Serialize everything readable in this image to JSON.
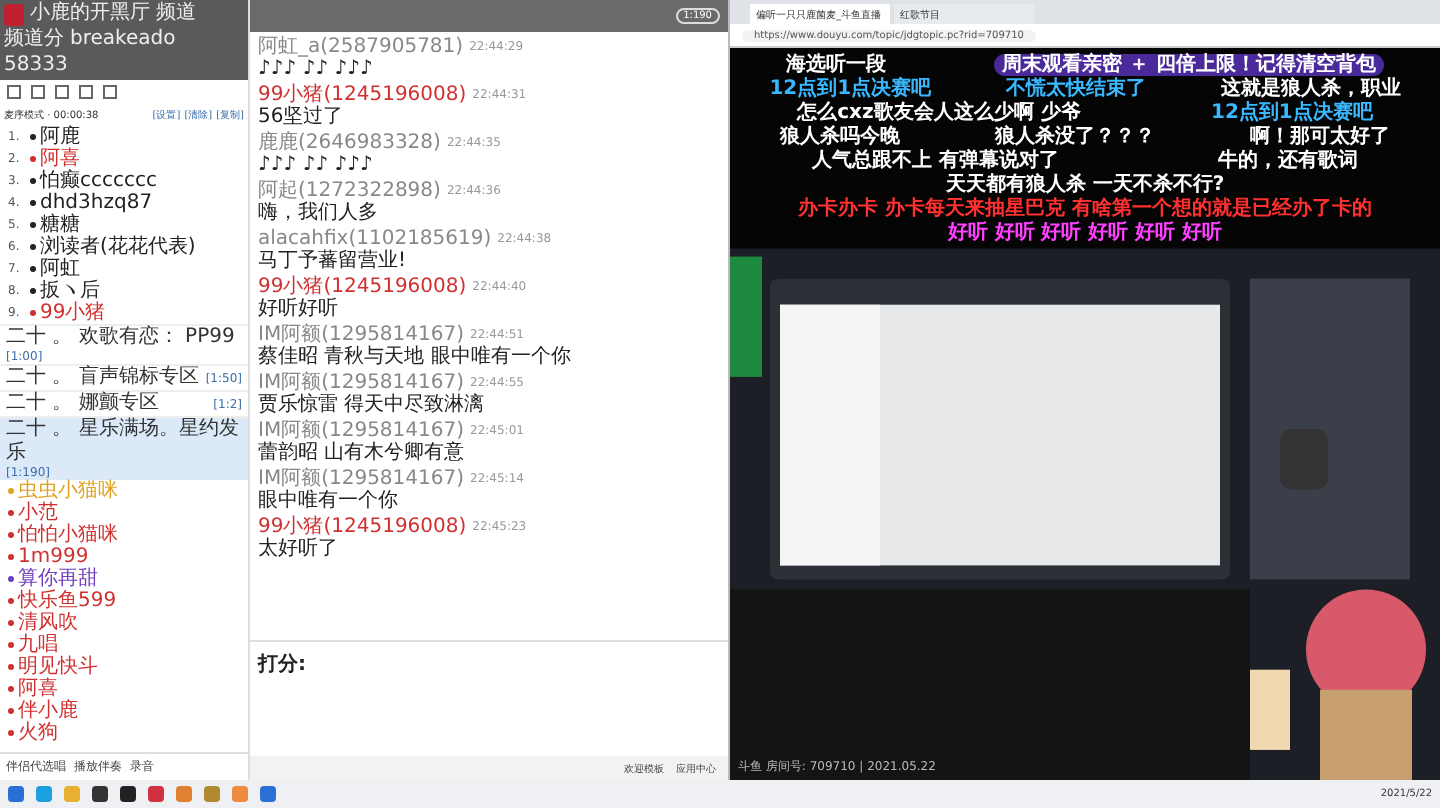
{
  "app": {
    "title": "小鹿的开黑厅",
    "nav": [
      "频道",
      "频道分",
      "breakeado"
    ],
    "count": "58333"
  },
  "mode": {
    "label": "麦序模式 · 00:00:38",
    "actions": [
      "[设置]",
      "[清除]",
      "[复制]"
    ]
  },
  "channels": [
    {
      "index": "1.",
      "name": "阿鹿",
      "color": "#222222"
    },
    {
      "index": "2.",
      "name": "阿喜",
      "color": "#d03030"
    },
    {
      "index": "3.",
      "name": "怕癫ccccccc",
      "color": "#222222"
    },
    {
      "index": "4.",
      "name": "dhd3hzq87",
      "color": "#222222"
    },
    {
      "index": "5.",
      "name": "糖糖",
      "color": "#222222"
    },
    {
      "index": "6.",
      "name": "浏读者(花花代表)",
      "color": "#222222"
    },
    {
      "index": "7.",
      "name": "阿虹",
      "color": "#222222"
    },
    {
      "index": "8.",
      "name": "扳ヽ后",
      "color": "#222222"
    },
    {
      "index": "9.",
      "name": "99小猪",
      "color": "#d03030"
    }
  ],
  "rooms": [
    {
      "name": "二十 。 欢歌有恋： PP99",
      "count": "[1:00]",
      "selected": false
    },
    {
      "name": "二十 。 盲声锦标专区",
      "count": "[1:50]",
      "selected": false
    },
    {
      "name": "二十 。 娜颤专区",
      "count": "[1:2]",
      "selected": false
    },
    {
      "name": "二十 。 星乐满场。星约发乐",
      "count": "[1:190]",
      "selected": true
    }
  ],
  "members": [
    {
      "name": "虫虫小猫咪",
      "color": "#e0a020"
    },
    {
      "name": "小范",
      "color": "#d03030"
    },
    {
      "name": "怕怕小猫咪",
      "color": "#d03030"
    },
    {
      "name": "1m999",
      "color": "#d03030"
    },
    {
      "name": "算你再甜",
      "color": "#7040c0"
    },
    {
      "name": "快乐鱼599",
      "color": "#d03030"
    },
    {
      "name": "清风吹",
      "color": "#d03030"
    },
    {
      "name": "九唱",
      "color": "#d03030"
    },
    {
      "name": "明见快斗",
      "color": "#d03030"
    },
    {
      "name": "阿喜",
      "color": "#d03030"
    },
    {
      "name": "伴小鹿",
      "color": "#d03030"
    },
    {
      "name": "火狗",
      "color": "#d03030"
    }
  ],
  "left_tools": [
    "伴侣代选唱",
    "播放伴奏",
    "录音"
  ],
  "chat_header": {
    "count": "1:190"
  },
  "messages": [
    {
      "sender": "阿虹_a(2587905781)",
      "time": "22:44:29",
      "text": "♪♪♪ ♪♪ ♪♪♪",
      "color": "#888888"
    },
    {
      "sender": "99小猪(1245196008)",
      "time": "22:44:31",
      "text": "56坚过了",
      "color": "#d03030"
    },
    {
      "sender": "鹿鹿(2646983328)",
      "time": "22:44:35",
      "text": "♪♪♪ ♪♪ ♪♪♪",
      "color": "#888888"
    },
    {
      "sender": "阿起(1272322898)",
      "time": "22:44:36",
      "text": "嗨，我们人多",
      "color": "#888888"
    },
    {
      "sender": "alacahfix(1102185619)",
      "time": "22:44:38",
      "text": "马丁予蕃留营业!",
      "color": "#888888"
    },
    {
      "sender": "99小猪(1245196008)",
      "time": "22:44:40",
      "text": "好听好听",
      "color": "#d03030"
    },
    {
      "sender": "IM阿额(1295814167)",
      "time": "22:44:51",
      "text": "蔡佳昭 青秋与天地 眼中唯有一个你",
      "color": "#888888"
    },
    {
      "sender": "IM阿额(1295814167)",
      "time": "22:44:55",
      "text": "贾乐惊雷 得天中尽致淋漓",
      "color": "#888888"
    },
    {
      "sender": "IM阿额(1295814167)",
      "time": "22:45:01",
      "text": "蕾韵昭 山有木兮卿有意",
      "color": "#888888"
    },
    {
      "sender": "IM阿额(1295814167)",
      "time": "22:45:14",
      "text": "眼中唯有一个你",
      "color": "#888888"
    },
    {
      "sender": "99小猪(1245196008)",
      "time": "22:45:23",
      "text": "太好听了",
      "color": "#d03030"
    }
  ],
  "input": {
    "label": "打分:"
  },
  "chat_footer": [
    "欢迎模板",
    "应用中心"
  ],
  "browser": {
    "tabs": [
      {
        "title": "偏听一只只鹿菌麦_斗鱼直播",
        "selected": true
      },
      {
        "title": "红歌节目",
        "selected": false
      }
    ],
    "url": "https://www.douyu.com/topic/jdgtopic.pc?rid=709710"
  },
  "danmaku_rows": [
    {
      "items": [
        {
          "kind": "text",
          "text": "海选听一段",
          "color": "#ffffff"
        },
        {
          "kind": "banner",
          "text": "周末观看亲密 ＋ 四倍上限！记得清空背包"
        }
      ]
    },
    {
      "items": [
        {
          "kind": "text",
          "text": "12点到1点决赛吧",
          "color": "#39b8ff"
        },
        {
          "kind": "text",
          "text": "不慌太快结束了",
          "color": "#39b8ff"
        },
        {
          "kind": "text",
          "text": "这就是狼人杀，职业",
          "color": "#ffffff"
        }
      ]
    },
    {
      "items": [
        {
          "kind": "text",
          "text": "怎么cxz歌友会人这么少啊 少爷",
          "color": "#ffffff"
        },
        {
          "kind": "text",
          "text": "12点到1点决赛吧",
          "color": "#39b8ff"
        }
      ]
    },
    {
      "items": [
        {
          "kind": "text",
          "text": "狼人杀吗今晚",
          "color": "#ffffff"
        },
        {
          "kind": "text",
          "text": "狼人杀没了？？？",
          "color": "#ffffff"
        },
        {
          "kind": "text",
          "text": "啊！那可太好了",
          "color": "#ffffff"
        }
      ]
    },
    {
      "items": [
        {
          "kind": "text",
          "text": "人气总跟不上 有弹幕说对了",
          "color": "#ffffff"
        },
        {
          "kind": "text",
          "text": "牛的，还有歌词",
          "color": "#ffffff"
        }
      ]
    },
    {
      "items": [
        {
          "kind": "text",
          "text": "天天都有狼人杀 一天不杀不行?",
          "color": "#ffffff"
        }
      ]
    },
    {
      "items": [
        {
          "kind": "text",
          "text": "办卡办卡 办卡每天来抽星巴克 有啥第一个想的就是已经办了卡的",
          "color": "#ff3030"
        }
      ]
    },
    {
      "items": [
        {
          "kind": "text",
          "text": "好听 好听 好听 好听 好听 好听",
          "color": "#ff40ff"
        }
      ]
    }
  ],
  "video_footer": {
    "text": "斗鱼 房间号: 709710 | 2021.05.22"
  },
  "taskbar": {
    "date": "2021/5/22"
  }
}
